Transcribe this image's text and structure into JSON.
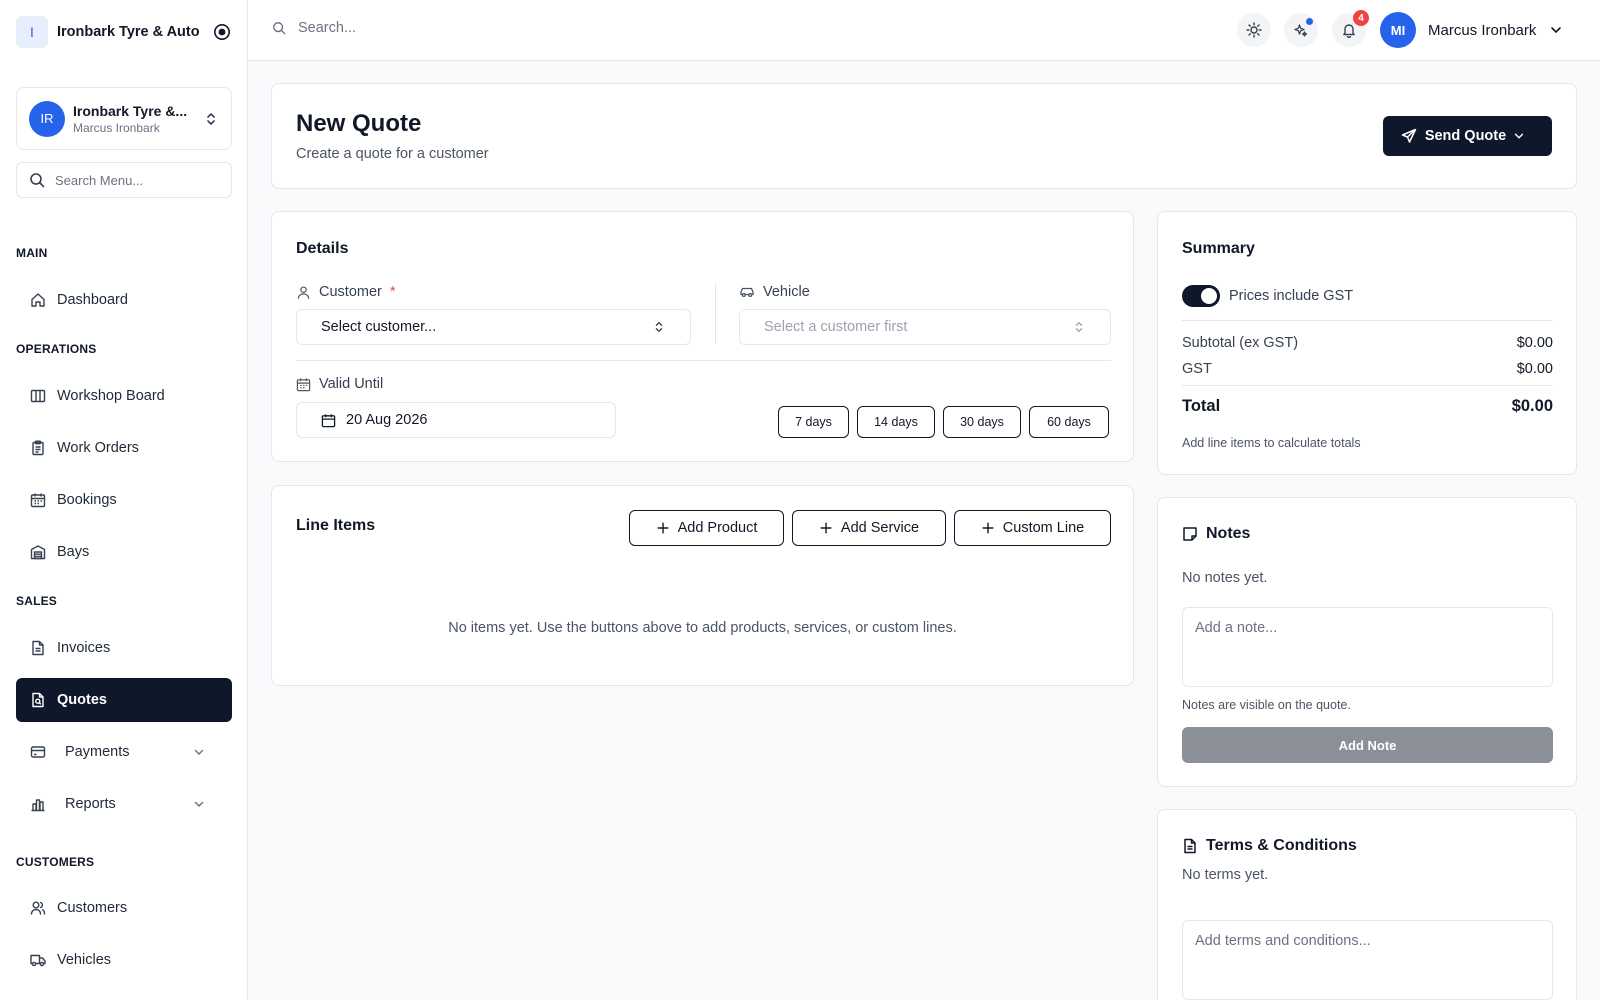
{
  "app": {
    "logo_letter": "I",
    "name": "Ironbark Tyre & Auto"
  },
  "org_switcher": {
    "initials": "IR",
    "name": "Ironbark Tyre &...",
    "user": "Marcus Ironbark"
  },
  "menu_search": {
    "placeholder": "Search Menu..."
  },
  "nav": {
    "sections": {
      "main": "MAIN",
      "operations": "OPERATIONS",
      "sales": "SALES",
      "customers": "CUSTOMERS"
    },
    "items": {
      "dashboard": "Dashboard",
      "workshop_board": "Workshop Board",
      "work_orders": "Work Orders",
      "bookings": "Bookings",
      "bays": "Bays",
      "invoices": "Invoices",
      "quotes": "Quotes",
      "payments": "Payments",
      "reports": "Reports",
      "customers": "Customers",
      "vehicles": "Vehicles"
    },
    "active": "quotes"
  },
  "topbar": {
    "search_placeholder": "Search...",
    "notification_count": "4",
    "user_initials": "MI",
    "user_name": "Marcus Ironbark"
  },
  "page": {
    "title": "New Quote",
    "subtitle": "Create a quote for a customer",
    "send_button": "Send Quote"
  },
  "details": {
    "title": "Details",
    "customer_label": "Customer",
    "required_marker": "*",
    "customer_value": "Select customer...",
    "vehicle_label": "Vehicle",
    "vehicle_value": "Select a customer first",
    "valid_until_label": "Valid Until",
    "valid_until_value": "20 Aug 2026",
    "presets": [
      "7 days",
      "14 days",
      "30 days",
      "60 days"
    ]
  },
  "line_items": {
    "title": "Line Items",
    "add_product": "Add Product",
    "add_service": "Add Service",
    "custom_line": "Custom Line",
    "empty_text": "No items yet. Use the buttons above to add products, services, or custom lines."
  },
  "summary": {
    "title": "Summary",
    "gst_toggle_label": "Prices include GST",
    "gst_toggle_on": true,
    "subtotal_label": "Subtotal (ex GST)",
    "subtotal_value": "$0.00",
    "gst_label": "GST",
    "gst_value": "$0.00",
    "total_label": "Total",
    "total_value": "$0.00",
    "note": "Add line items to calculate totals"
  },
  "notes": {
    "title": "Notes",
    "empty": "No notes yet.",
    "placeholder": "Add a note...",
    "hint": "Notes are visible on the quote.",
    "add_button": "Add Note"
  },
  "terms": {
    "title": "Terms & Conditions",
    "empty": "No terms yet.",
    "placeholder": "Add terms and conditions..."
  },
  "colors": {
    "primary_dark": "#0f172a",
    "accent_blue": "#2563eb",
    "badge_red": "#ef4444",
    "page_bg": "#f8fafc",
    "border": "#e5e7eb"
  }
}
